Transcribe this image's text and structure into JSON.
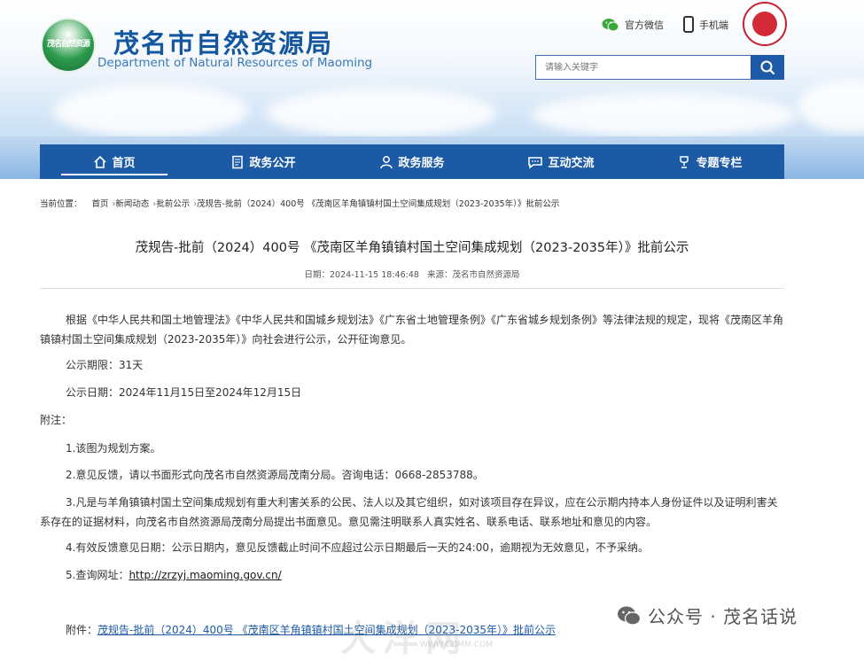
{
  "header": {
    "logo_text": "茂名自然资源",
    "title_cn": "茂名市自然资源局",
    "title_en": "Department of Natural Resources of Maoming",
    "wechat_label": "官方微信",
    "mobile_label": "手机端",
    "search_placeholder": "请输入关键字",
    "icons": {
      "wechat": "wechat-icon",
      "mobile": "mobile-icon",
      "search": "search-icon",
      "emblem": "city-emblem-icon"
    }
  },
  "nav": {
    "items": [
      {
        "label": "首页",
        "icon": "home-icon",
        "active": true
      },
      {
        "label": "政务公开",
        "icon": "document-icon"
      },
      {
        "label": "政务服务",
        "icon": "service-person-icon"
      },
      {
        "label": "互动交流",
        "icon": "chat-icon"
      },
      {
        "label": "专题专栏",
        "icon": "trophy-icon"
      }
    ]
  },
  "breadcrumb": {
    "prefix": "当前位置：",
    "items": [
      "首页",
      "新闻动态",
      "批前公示",
      "茂规告-批前（2024）400号 《茂南区羊角镇镇村国土空间集成规划（2023-2035年）》批前公示"
    ]
  },
  "article": {
    "title": "茂规告-批前（2024）400号 《茂南区羊角镇镇村国土空间集成规划（2023-2035年）》批前公示",
    "date_label": "日期：",
    "date": "2024-11-15 18:46:48",
    "source_label": "来源：",
    "source": "茂名市自然资源局",
    "intro": "根据《中华人民共和国土地管理法》《中华人民共和国城乡规划法》《广东省土地管理条例》《广东省城乡规划条例》等法律法规的规定，现将《茂南区羊角镇镇村国土空间集成规划（2023-2035年）》向社会进行公示，公开征询意见。",
    "period": "公示期限：31天",
    "dates": "公示日期：2024年11月15日至2024年12月15日",
    "notes_label": "附注：",
    "note1": "1.该图为规划方案。",
    "note2": "2.意见反馈，请以书面形式向茂名市自然资源局茂南分局。咨询电话：0668-2853788。",
    "note3": "3.凡是与羊角镇镇村国土空间集成规划有重大利害关系的公民、法人以及其它组织，如对该项目存在异议，应在公示期内持本人身份证件以及证明利害关系存在的证据材料，向茂名市自然资源局茂南分局提出书面意见。意见需注明联系人真实姓名、联系电话、联系地址和意见的内容。",
    "note4": "4.有效反馈意见日期：公示日期内，意见反馈截止时间不应超过公示日期最后一天的24:00，逾期视为无效意见，不予采纳。",
    "note5_prefix": "5.查询网址：",
    "note5_url": "http://zrzyj.maoming.gov.cn/",
    "attachment_label": "附件：",
    "attachment": "茂规告-批前（2024）400号 《茂南区羊角镇镇村国土空间集成规划（2023-2035年）》批前公示"
  },
  "overlay": {
    "watermark": "大洋网",
    "watermark_url": "WWW.GDMM.COM",
    "wechat_account": "公众号 · 茂名话说"
  }
}
